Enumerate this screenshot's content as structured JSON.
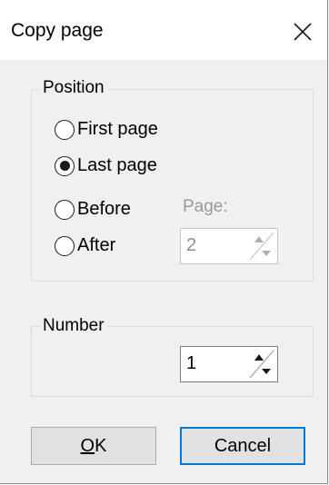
{
  "dialog": {
    "title": "Copy page",
    "close_icon": "close-icon"
  },
  "position_group": {
    "label": "Position",
    "options": [
      {
        "label": "First page",
        "selected": false
      },
      {
        "label": "Last page",
        "selected": true
      },
      {
        "label": "Before",
        "selected": false
      },
      {
        "label": "After",
        "selected": false
      }
    ],
    "page_label": "Page:",
    "page_value": "2",
    "page_enabled": false
  },
  "number_group": {
    "label": "Number",
    "value": "1"
  },
  "buttons": {
    "ok_label": "OK",
    "ok_mnemonic": "O",
    "ok_rest": "K",
    "cancel_label": "Cancel"
  },
  "colors": {
    "focus_border": "#0078d7",
    "dialog_bg": "#f0f0f0"
  }
}
